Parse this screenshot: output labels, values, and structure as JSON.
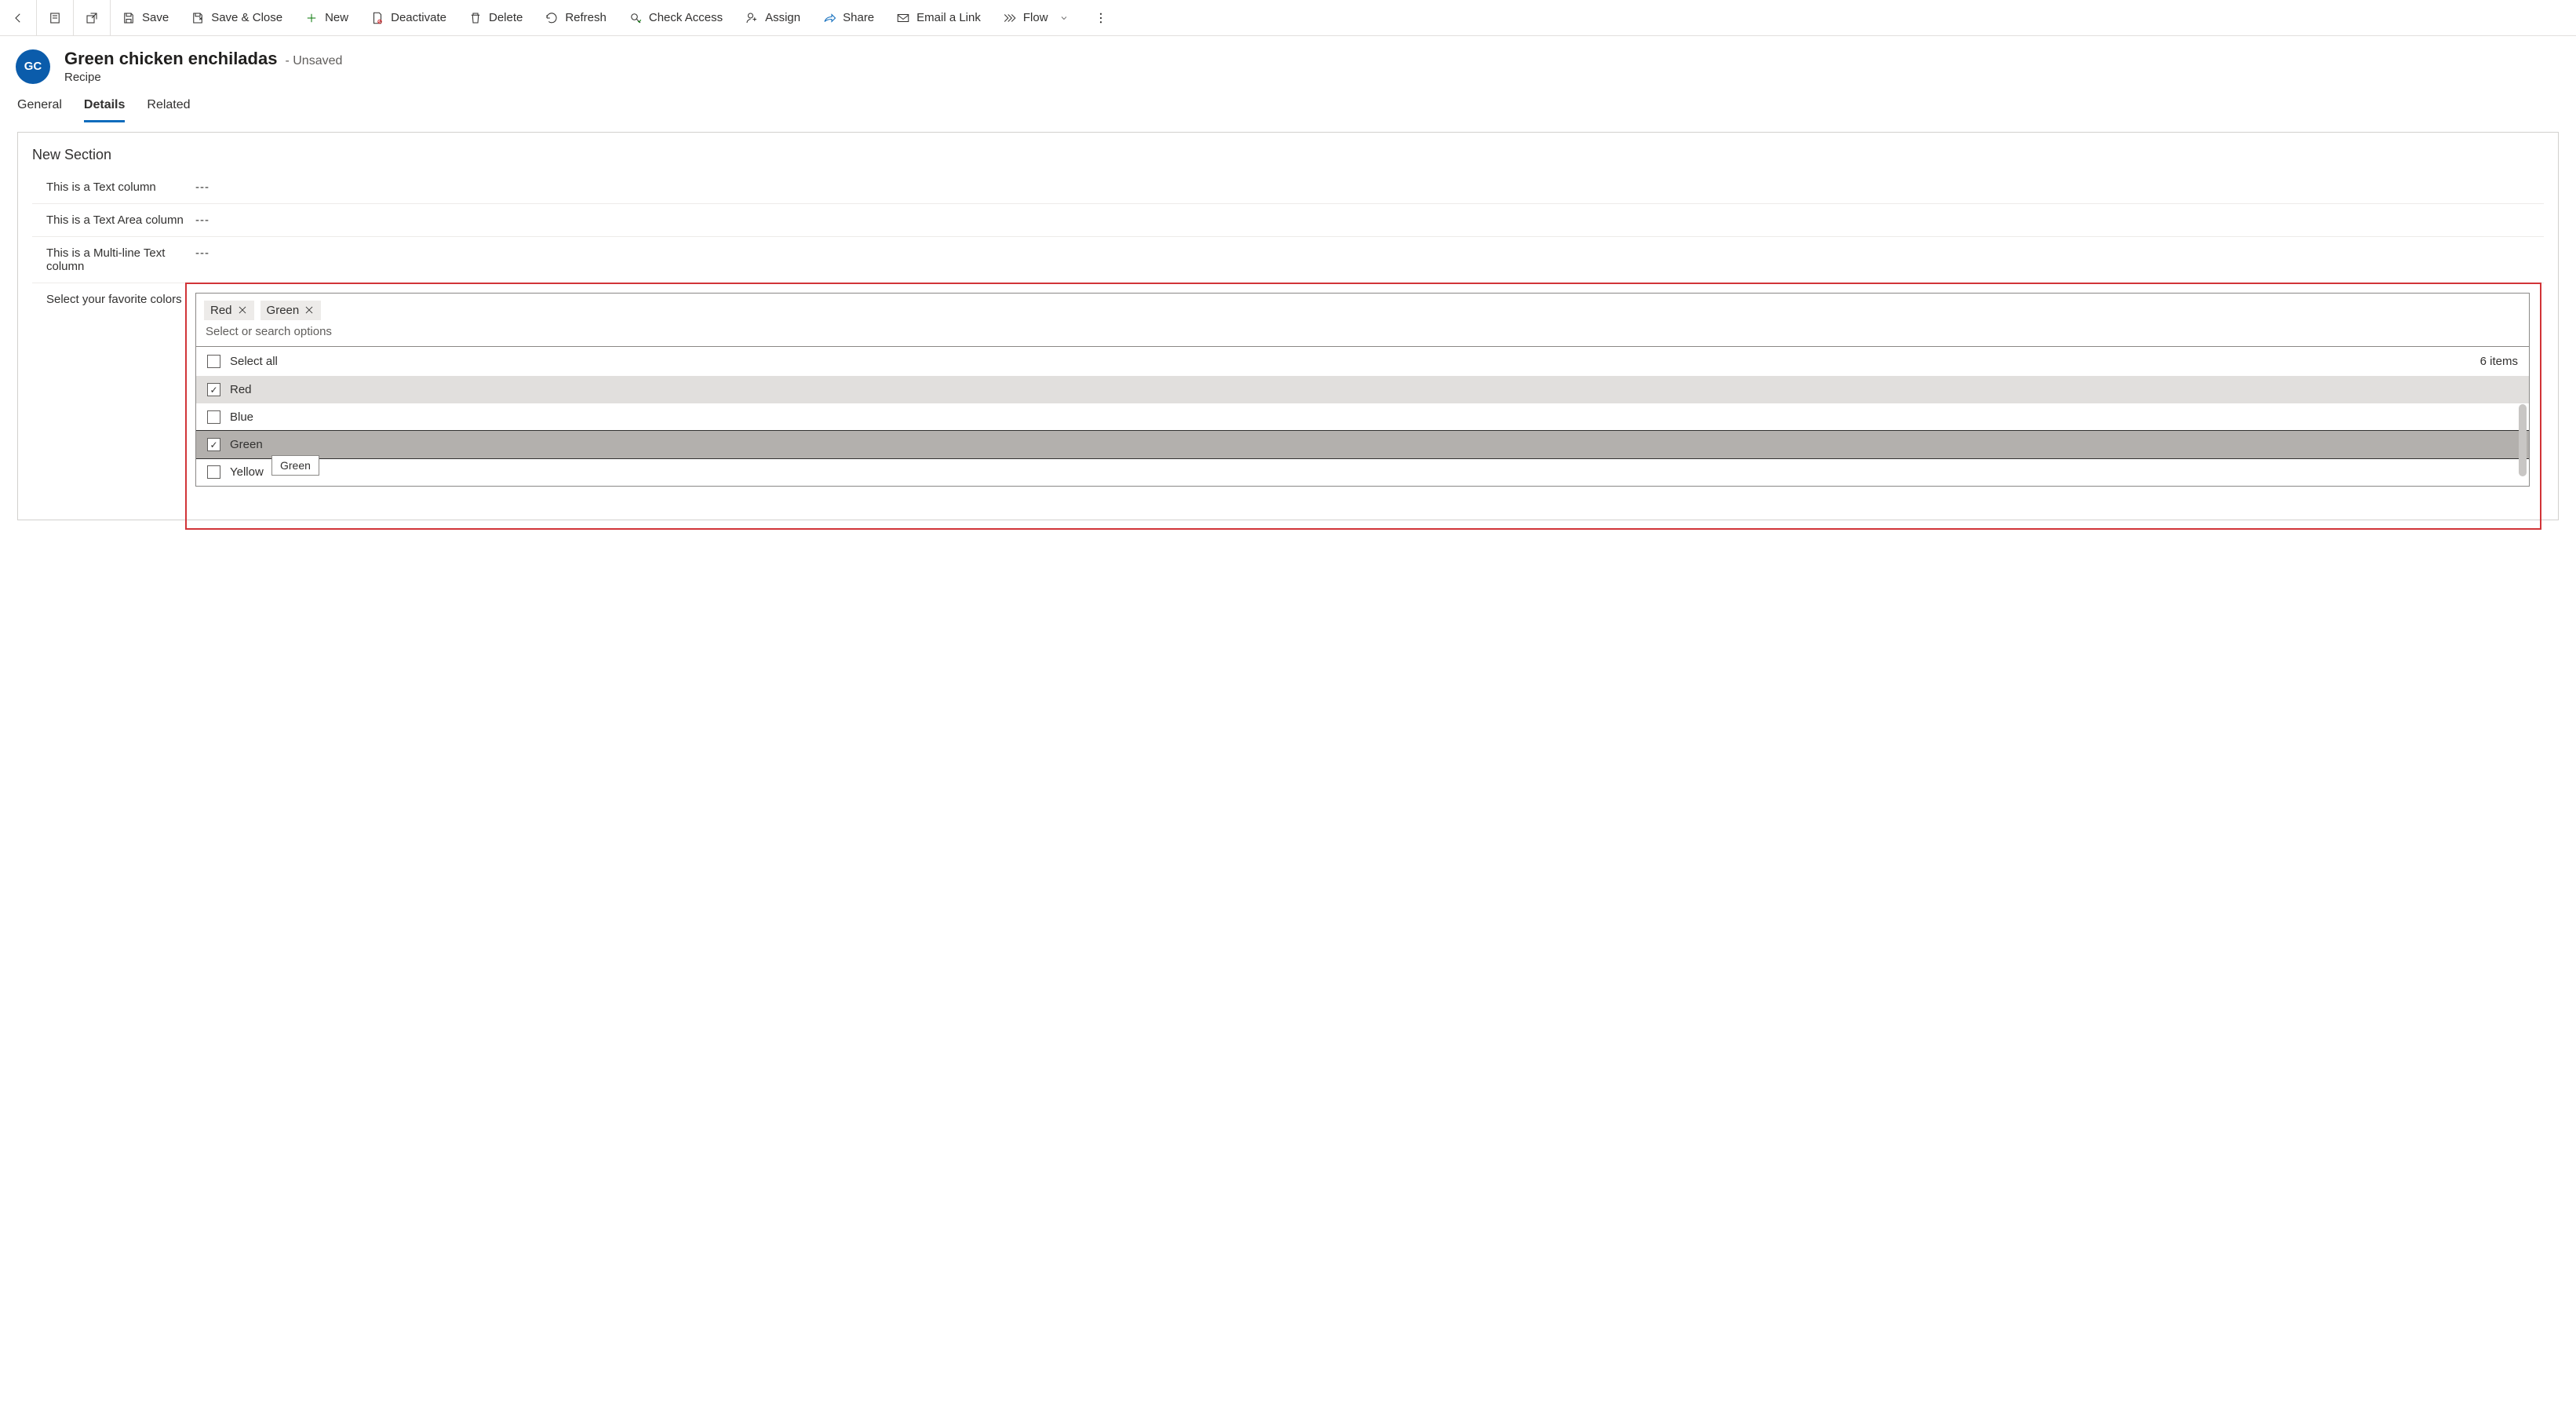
{
  "commands": {
    "save": "Save",
    "save_close": "Save & Close",
    "new": "New",
    "deactivate": "Deactivate",
    "delete": "Delete",
    "refresh": "Refresh",
    "check_access": "Check Access",
    "assign": "Assign",
    "share": "Share",
    "email_link": "Email a Link",
    "flow": "Flow"
  },
  "header": {
    "avatar_initials": "GC",
    "title": "Green chicken enchiladas",
    "suffix": "- Unsaved",
    "subtitle": "Recipe"
  },
  "tabs": {
    "general": "General",
    "details": "Details",
    "related": "Related"
  },
  "section": {
    "title": "New Section",
    "field1_label": "This is a Text column",
    "field1_value": "---",
    "field2_label": "This is a Text Area column",
    "field2_value": "---",
    "field3_label": "This is a Multi-line Text column",
    "field3_value": "---",
    "field4_label": "Select your favorite colors"
  },
  "multiselect": {
    "chip1": "Red",
    "chip2": "Green",
    "search_placeholder": "Select or search options",
    "select_all": "Select all",
    "count_text": "6 items",
    "options": {
      "red": "Red",
      "blue": "Blue",
      "green": "Green",
      "yellow": "Yellow"
    },
    "tooltip": "Green"
  }
}
